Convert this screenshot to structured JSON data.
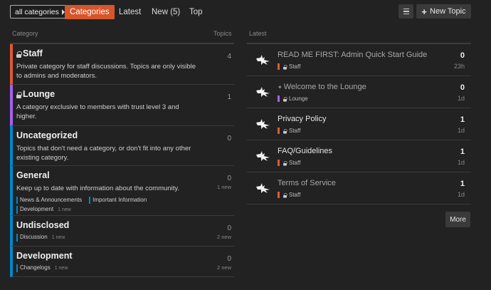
{
  "nav": {
    "category_dropdown": "all categories",
    "tabs": [
      "Categories",
      "Latest",
      "New (5)",
      "Top"
    ],
    "new_topic": "New Topic"
  },
  "categories_table": {
    "header_category": "Category",
    "header_topics": "Topics",
    "rows": [
      {
        "name": "Staff",
        "locked": true,
        "color": "#e45735",
        "desc": "Private category for staff discussions. Topics are only visible to admins and moderators.",
        "count": "4",
        "new": "",
        "subcategories": []
      },
      {
        "name": "Lounge",
        "locked": true,
        "color": "#a461ef",
        "desc": "A category exclusive to members with trust level 3 and higher.",
        "count": "1",
        "new": "",
        "subcategories": []
      },
      {
        "name": "Uncategorized",
        "locked": false,
        "color": "#0088cc",
        "desc": "Topics that don't need a category, or don't fit into any other existing category.",
        "count": "0",
        "new": "",
        "subcategories": []
      },
      {
        "name": "General",
        "locked": false,
        "color": "#0088cc",
        "desc": "Keep up to date with information about the community.",
        "count": "0",
        "new": "1 new",
        "subcategories": [
          {
            "name": "News & Announcements",
            "new": ""
          },
          {
            "name": "Important Information",
            "new": ""
          },
          {
            "name": "Development",
            "new": "1 new"
          }
        ]
      },
      {
        "name": "Undisclosed",
        "locked": false,
        "color": "#0088cc",
        "desc": "",
        "count": "0",
        "new": "2 new",
        "subcategories": [
          {
            "name": "Discussion",
            "new": "1 new"
          }
        ]
      },
      {
        "name": "Development",
        "locked": false,
        "color": "#0088cc",
        "desc": "",
        "count": "0",
        "new": "2 new",
        "subcategories": [
          {
            "name": "Changelogs",
            "new": "1 new"
          }
        ]
      }
    ]
  },
  "latest": {
    "header": "Latest",
    "topics": [
      {
        "title": "READ ME FIRST: Admin Quick Start Guide",
        "pinned": false,
        "read": true,
        "category": "Staff",
        "cat_color": "#e45735",
        "locked": true,
        "count": "0",
        "age": "23h"
      },
      {
        "title": "Welcome to the Lounge",
        "pinned": true,
        "read": true,
        "category": "Lounge",
        "cat_color": "#a461ef",
        "locked": true,
        "count": "0",
        "age": "1d"
      },
      {
        "title": "Privacy Policy",
        "pinned": false,
        "read": false,
        "category": "Staff",
        "cat_color": "#e45735",
        "locked": true,
        "count": "1",
        "age": "1d"
      },
      {
        "title": "FAQ/Guidelines",
        "pinned": false,
        "read": false,
        "category": "Staff",
        "cat_color": "#e45735",
        "locked": true,
        "count": "1",
        "age": "1d"
      },
      {
        "title": "Terms of Service",
        "pinned": false,
        "read": true,
        "category": "Staff",
        "cat_color": "#e45735",
        "locked": true,
        "count": "1",
        "age": "1d"
      }
    ],
    "more": "More"
  }
}
